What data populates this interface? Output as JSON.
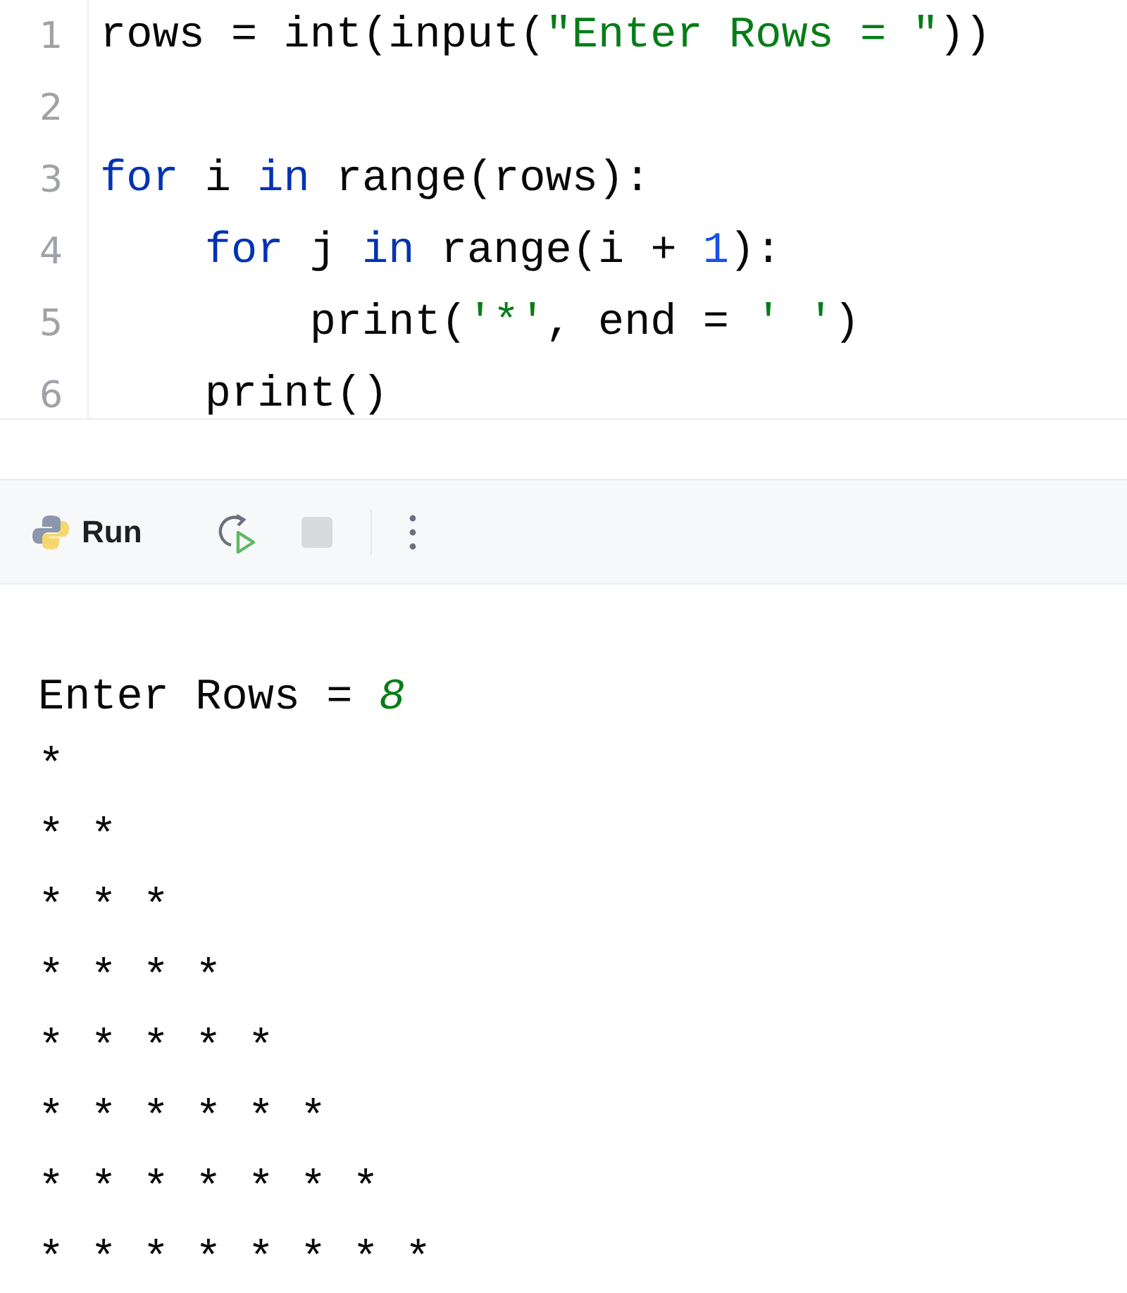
{
  "editor": {
    "lines": [
      {
        "number": "1",
        "tokens": [
          {
            "text": "rows = int(input(",
            "kind": "plain"
          },
          {
            "text": "\"Enter Rows = \"",
            "kind": "string"
          },
          {
            "text": "))",
            "kind": "plain"
          }
        ]
      },
      {
        "number": "2"
      },
      {
        "number": "3",
        "tokens": [
          {
            "text": "for",
            "kind": "keyword"
          },
          {
            "text": " i ",
            "kind": "plain"
          },
          {
            "text": "in",
            "kind": "keyword"
          },
          {
            "text": " range(rows):",
            "kind": "plain"
          }
        ]
      },
      {
        "number": "4",
        "tokens": [
          {
            "text": "    for",
            "kind": "keyword"
          },
          {
            "text": " j ",
            "kind": "plain"
          },
          {
            "text": "in",
            "kind": "keyword"
          },
          {
            "text": " range(i + ",
            "kind": "plain"
          },
          {
            "text": "1",
            "kind": "number"
          },
          {
            "text": "):",
            "kind": "plain"
          }
        ]
      },
      {
        "number": "5",
        "tokens": [
          {
            "text": "        print(",
            "kind": "plain"
          },
          {
            "text": "'*'",
            "kind": "string"
          },
          {
            "text": ", end = ",
            "kind": "plain"
          },
          {
            "text": "' '",
            "kind": "string"
          },
          {
            "text": ")",
            "kind": "plain"
          }
        ]
      },
      {
        "number": "6",
        "tokens": [
          {
            "text": "    print()",
            "kind": "plain"
          }
        ]
      }
    ]
  },
  "run_toolbar": {
    "title": "Run",
    "buttons": [
      {
        "kind": "rerun",
        "disabled": false
      },
      {
        "kind": "stop",
        "disabled": true
      },
      {
        "kind": "more",
        "disabled": false
      }
    ]
  },
  "console": {
    "prompt": "Enter Rows = ",
    "entered_value": "8",
    "output": "*\n* *\n* * *\n* * * *\n* * * * *\n* * * * * *\n* * * * * * *\n* * * * * * * *"
  }
}
